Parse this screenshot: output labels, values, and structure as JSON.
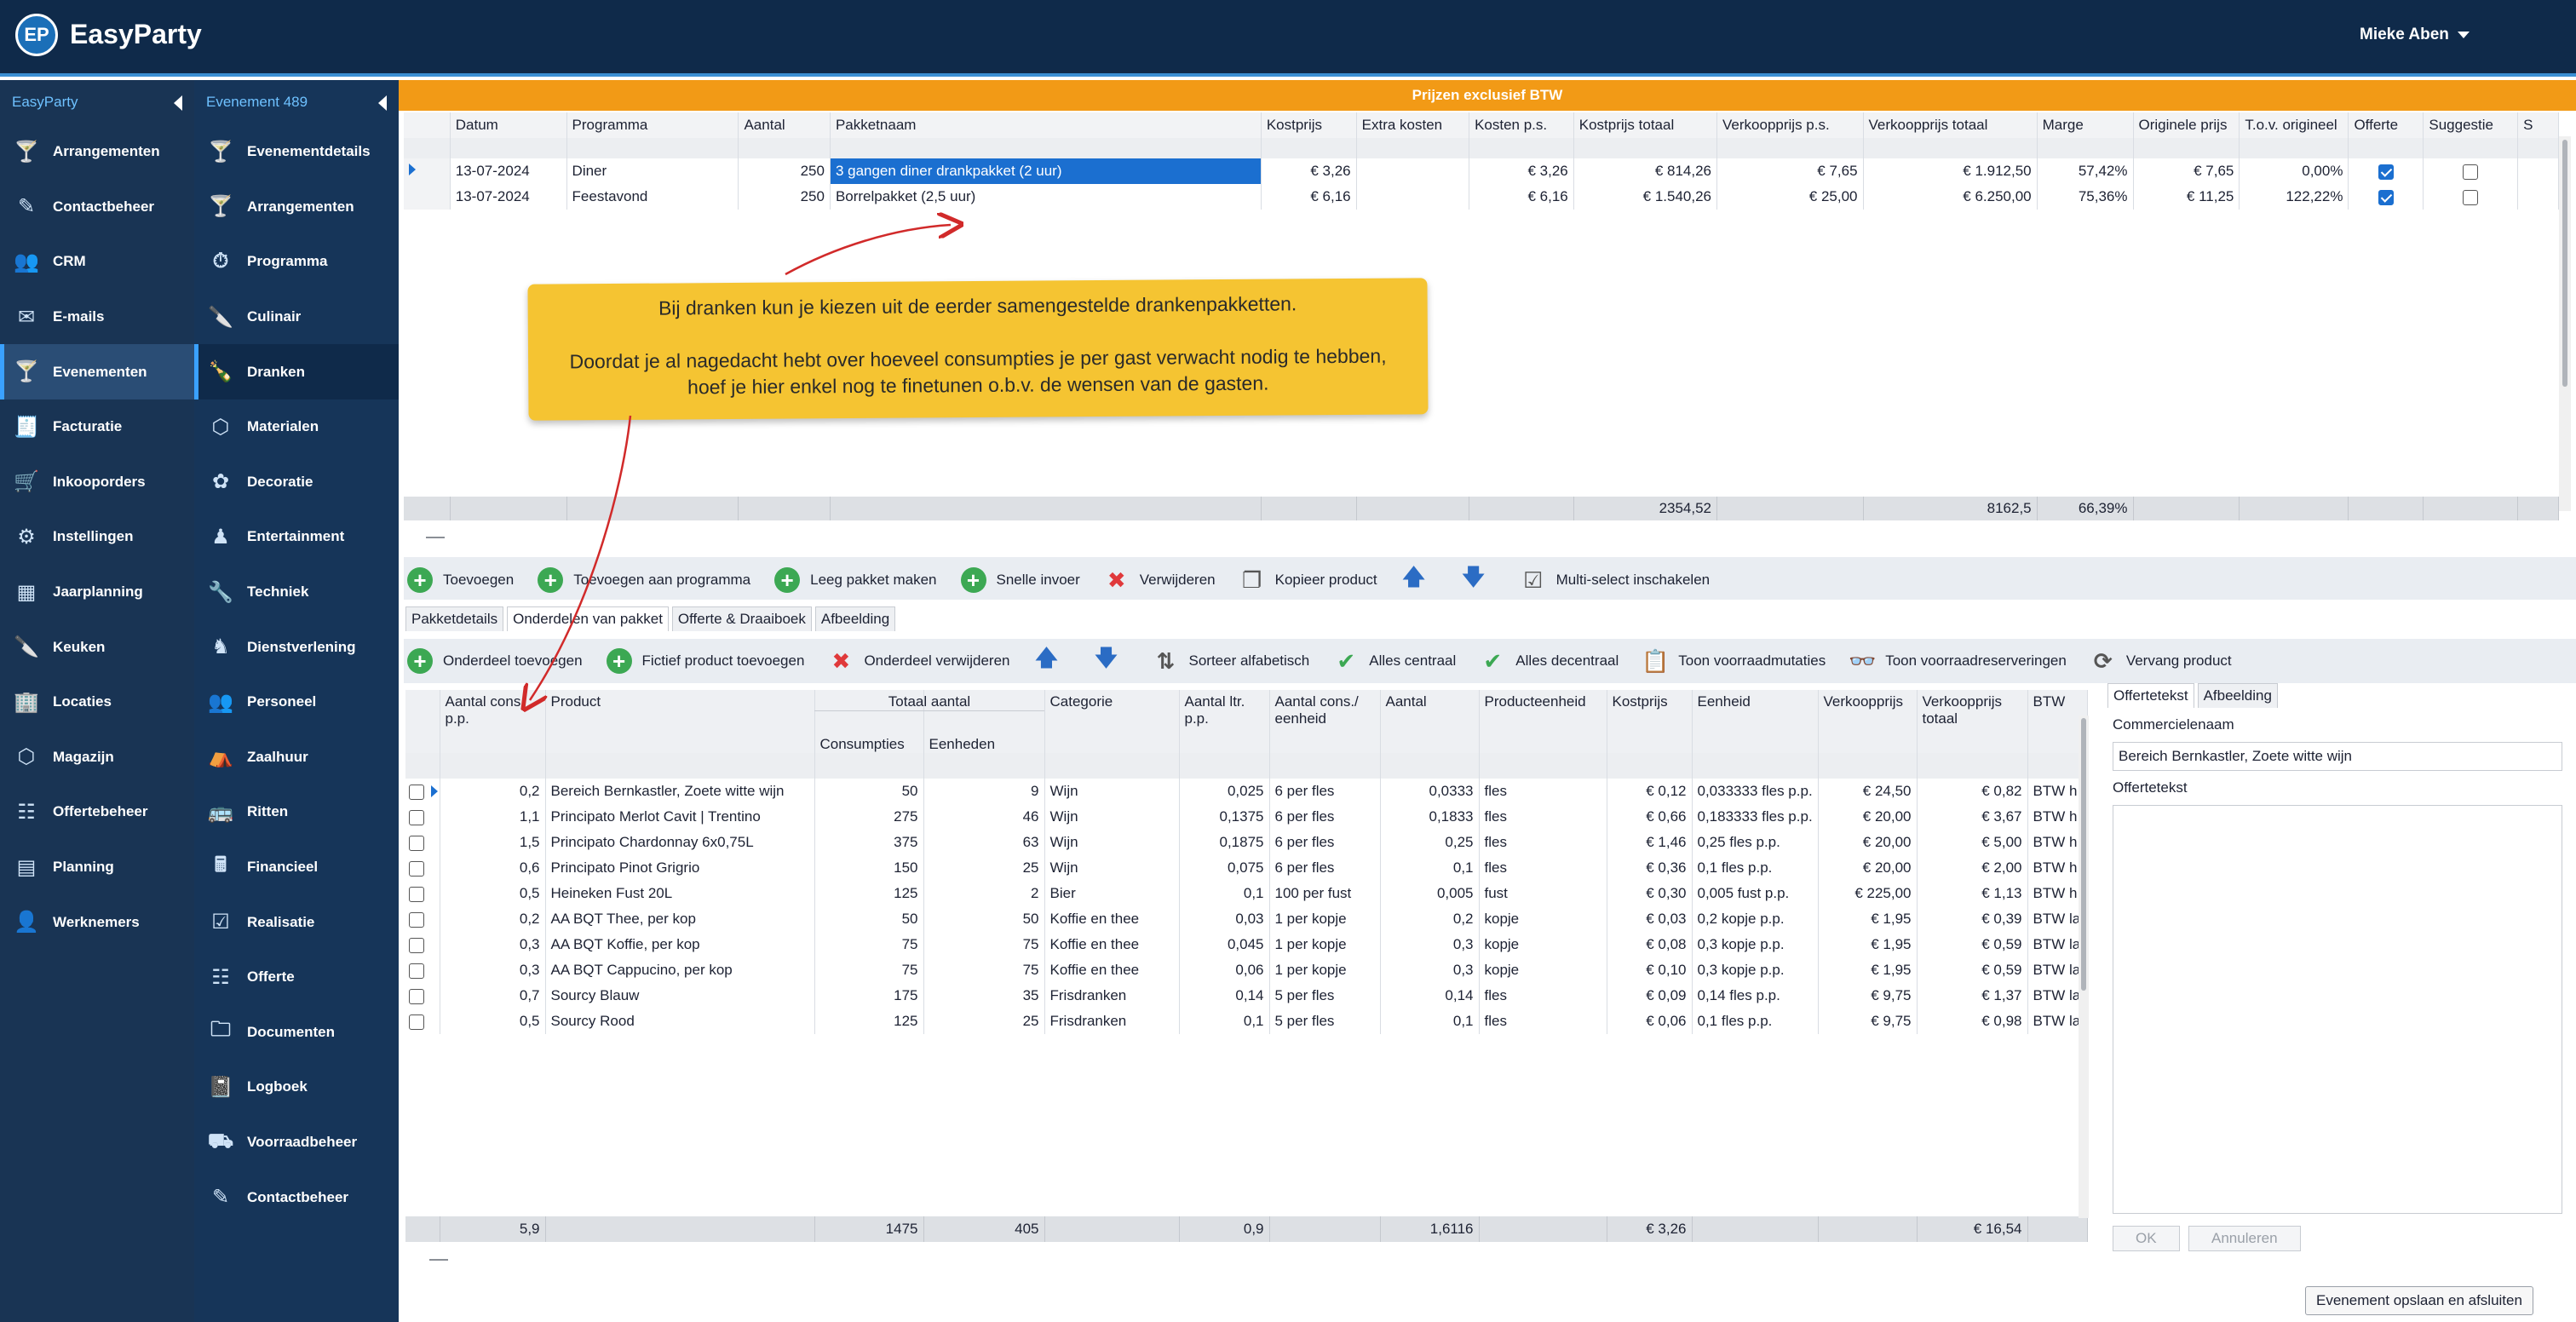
{
  "header": {
    "logo_text": "EP",
    "app_name": "EasyParty",
    "user_name": "Mieke Aben"
  },
  "sidebar1": {
    "title": "EasyParty",
    "items": [
      {
        "label": "Arrangementen",
        "icon": "cocktail-icon"
      },
      {
        "label": "Contactbeheer",
        "icon": "edit-icon"
      },
      {
        "label": "CRM",
        "icon": "users-icon"
      },
      {
        "label": "E-mails",
        "icon": "mail-icon"
      },
      {
        "label": "Evenementen",
        "icon": "cocktail-glass-icon"
      },
      {
        "label": "Facturatie",
        "icon": "invoice-icon"
      },
      {
        "label": "Inkooporders",
        "icon": "cart-icon"
      },
      {
        "label": "Instellingen",
        "icon": "gear-icon"
      },
      {
        "label": "Jaarplanning",
        "icon": "calendar-icon"
      },
      {
        "label": "Keuken",
        "icon": "knife-icon"
      },
      {
        "label": "Locaties",
        "icon": "buildings-icon"
      },
      {
        "label": "Magazijn",
        "icon": "box-icon"
      },
      {
        "label": "Offertebeheer",
        "icon": "quote-icon"
      },
      {
        "label": "Planning",
        "icon": "planning-icon"
      },
      {
        "label": "Werknemers",
        "icon": "person-icon"
      }
    ]
  },
  "sidebar2": {
    "title": "Evenement 489",
    "items": [
      {
        "label": "Evenementdetails",
        "icon": "cocktail-glass-icon"
      },
      {
        "label": "Arrangementen",
        "icon": "cocktail-icon"
      },
      {
        "label": "Programma",
        "icon": "stopwatch-icon"
      },
      {
        "label": "Culinair",
        "icon": "knife-icon"
      },
      {
        "label": "Dranken",
        "icon": "bottle-icon"
      },
      {
        "label": "Materialen",
        "icon": "box-icon"
      },
      {
        "label": "Decoratie",
        "icon": "flower-icon"
      },
      {
        "label": "Entertainment",
        "icon": "performer-icon"
      },
      {
        "label": "Techniek",
        "icon": "wrench-icon"
      },
      {
        "label": "Dienstverlening",
        "icon": "service-icon"
      },
      {
        "label": "Personeel",
        "icon": "users-icon"
      },
      {
        "label": "Zaalhuur",
        "icon": "hall-icon"
      },
      {
        "label": "Ritten",
        "icon": "bus-icon"
      },
      {
        "label": "Financieel",
        "icon": "finance-icon"
      },
      {
        "label": "Realisatie",
        "icon": "checklist-icon"
      },
      {
        "label": "Offerte",
        "icon": "quote-icon"
      },
      {
        "label": "Documenten",
        "icon": "folder-icon"
      },
      {
        "label": "Logboek",
        "icon": "logbook-icon"
      },
      {
        "label": "Voorraadbeheer",
        "icon": "forklift-icon"
      },
      {
        "label": "Contactbeheer",
        "icon": "edit-icon"
      }
    ]
  },
  "banner": "Prijzen exclusief BTW",
  "top_table": {
    "columns": [
      "Datum",
      "Programma",
      "Aantal",
      "Pakketnaam",
      "Kostprijs",
      "Extra kosten",
      "Kosten p.s.",
      "Kostprijs totaal",
      "Verkoopprijs p.s.",
      "Verkoopprijs totaal",
      "Marge",
      "Originele prijs",
      "T.o.v. origineel",
      "Offerte",
      "Suggestie",
      "S"
    ],
    "rows": [
      [
        "13-07-2024",
        "Diner",
        "250",
        "3 gangen diner drankpakket (2 uur)",
        "€ 3,26",
        "",
        "€ 3,26",
        "€ 814,26",
        "€ 7,65",
        "€ 1.912,50",
        "57,42%",
        "€ 7,65",
        "0,00%"
      ],
      [
        "13-07-2024",
        "Feestavond",
        "250",
        "Borrelpakket (2,5 uur)",
        "€ 6,16",
        "",
        "€ 6,16",
        "€ 1.540,26",
        "€ 25,00",
        "€ 6.250,00",
        "75,36%",
        "€ 11,25",
        "122,22%"
      ]
    ],
    "totals": {
      "kostprijs_totaal": "2354,52",
      "verkoopprijs_totaal": "8162,5",
      "marge": "66,39%"
    }
  },
  "toolbar1": [
    "Toevoegen",
    "Toevoegen aan programma",
    "Leeg pakket maken",
    "Snelle invoer",
    "Verwijderen",
    "Kopieer product",
    "Multi-select inschakelen"
  ],
  "tabs1": [
    "Pakketdetails",
    "Onderdelen van pakket",
    "Offerte & Draaiboek",
    "Afbeelding"
  ],
  "toolbar2": [
    "Onderdeel toevoegen",
    "Fictief product toevoegen",
    "Onderdeel verwijderen",
    "Sorteer alfabetisch",
    "Alles centraal",
    "Alles decentraal",
    "Toon voorraadmutaties",
    "Toon voorraadreserveringen",
    "Vervang product"
  ],
  "bottom_table": {
    "group_header": "Totaal aantal",
    "columns": [
      "Aantal cons. p.p.",
      "Product",
      "Consumpties",
      "Eenheden",
      "Categorie",
      "Aantal ltr. p.p.",
      "Aantal cons./ eenheid",
      "Aantal",
      "Producteenheid",
      "Kostprijs",
      "Eenheid",
      "Verkoopprijs",
      "Verkoopprijs totaal",
      "BTW"
    ],
    "rows": [
      [
        "0,2",
        "Bereich Bernkastler, Zoete witte wijn",
        "50",
        "9",
        "Wijn",
        "0,025",
        "6 per fles",
        "0,0333",
        "fles",
        "€ 0,12",
        "0,033333 fles p.p.",
        "€ 24,50",
        "€ 0,82",
        "BTW h"
      ],
      [
        "1,1",
        "Principato Merlot Cavit | Trentino",
        "275",
        "46",
        "Wijn",
        "0,1375",
        "6 per fles",
        "0,1833",
        "fles",
        "€ 0,66",
        "0,183333 fles p.p.",
        "€ 20,00",
        "€ 3,67",
        "BTW h"
      ],
      [
        "1,5",
        "Principato Chardonnay 6x0,75L",
        "375",
        "63",
        "Wijn",
        "0,1875",
        "6 per fles",
        "0,25",
        "fles",
        "€ 1,46",
        "0,25 fles p.p.",
        "€ 20,00",
        "€ 5,00",
        "BTW h"
      ],
      [
        "0,6",
        "Principato Pinot Grigrio",
        "150",
        "25",
        "Wijn",
        "0,075",
        "6 per fles",
        "0,1",
        "fles",
        "€ 0,36",
        "0,1 fles p.p.",
        "€ 20,00",
        "€ 2,00",
        "BTW h"
      ],
      [
        "0,5",
        "Heineken Fust 20L",
        "125",
        "2",
        "Bier",
        "0,1",
        "100 per fust",
        "0,005",
        "fust",
        "€ 0,30",
        "0,005 fust p.p.",
        "€ 225,00",
        "€ 1,13",
        "BTW h"
      ],
      [
        "0,2",
        "AA BQT Thee, per kop",
        "50",
        "50",
        "Koffie en thee",
        "0,03",
        "1 per kopje",
        "0,2",
        "kopje",
        "€ 0,03",
        "0,2 kopje p.p.",
        "€ 1,95",
        "€ 0,39",
        "BTW la"
      ],
      [
        "0,3",
        "AA BQT Koffie, per kop",
        "75",
        "75",
        "Koffie en thee",
        "0,045",
        "1 per kopje",
        "0,3",
        "kopje",
        "€ 0,08",
        "0,3 kopje p.p.",
        "€ 1,95",
        "€ 0,59",
        "BTW la"
      ],
      [
        "0,3",
        "AA BQT Cappucino, per kop",
        "75",
        "75",
        "Koffie en thee",
        "0,06",
        "1 per kopje",
        "0,3",
        "kopje",
        "€ 0,10",
        "0,3 kopje p.p.",
        "€ 1,95",
        "€ 0,59",
        "BTW la"
      ],
      [
        "0,7",
        "Sourcy Blauw",
        "175",
        "35",
        "Frisdranken",
        "0,14",
        "5 per fles",
        "0,14",
        "fles",
        "€ 0,09",
        "0,14 fles p.p.",
        "€ 9,75",
        "€ 1,37",
        "BTW la"
      ],
      [
        "0,5",
        "Sourcy Rood",
        "125",
        "25",
        "Frisdranken",
        "0,1",
        "5 per fles",
        "0,1",
        "fles",
        "€ 0,06",
        "0,1 fles p.p.",
        "€ 9,75",
        "€ 0,98",
        "BTW la"
      ]
    ],
    "totals": [
      "5,9",
      "",
      "1475",
      "405",
      "",
      "0,9",
      "",
      "1,6116",
      "",
      "€ 3,26",
      "",
      "",
      "€ 16,54",
      ""
    ]
  },
  "right_panel": {
    "tabs": [
      "Offertetekst",
      "Afbeelding"
    ],
    "commercial_label": "Commercielenaam",
    "commercial_value": "Bereich Bernkastler, Zoete witte wijn",
    "quote_label": "Offertetekst",
    "ok": "OK",
    "cancel": "Annuleren"
  },
  "save_button": "Evenement opslaan en afsluiten",
  "callout": {
    "line1": "Bij dranken kun je kiezen uit de eerder samengestelde drankenpakketten.",
    "line2": "Doordat je al nagedacht hebt over hoeveel consumpties je per gast verwacht nodig te hebben, hoef je hier enkel nog te finetunen o.b.v. de wensen van de gasten."
  },
  "colors": {
    "topbar": "#0f2a4a",
    "sidebar": "#193454",
    "banner": "#f29a16",
    "callout": "#f5c432",
    "selection": "#1b6fd0"
  }
}
